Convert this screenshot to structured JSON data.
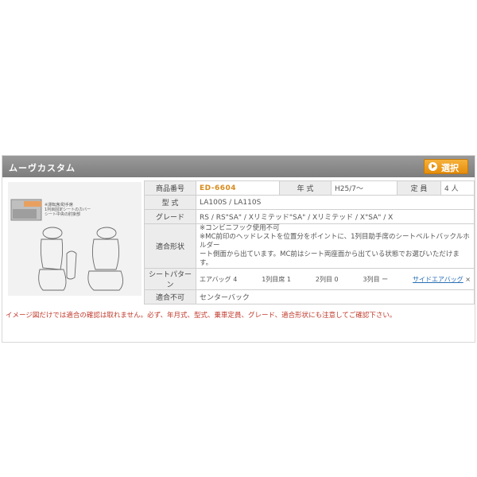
{
  "panel": {
    "title": "ムーヴカスタム",
    "select_label": "選択"
  },
  "image": {
    "caption_lines": [
      "※運転席/助手席",
      "1列目固定シートのカバー",
      "シート中央の肘掛部"
    ]
  },
  "spec": {
    "product_no_label": "商品番号",
    "product_no": "ED-6604",
    "year_label": "年 式",
    "year": "H25/7～",
    "capacity_label": "定 員",
    "capacity": "4 人",
    "model_label": "型 式",
    "model": "LA100S / LA110S",
    "grade_label": "グレード",
    "grade": "RS / RS\"SA\" / Xリミテッド\"SA\" / Xリミテッド / X\"SA\" / X",
    "fit_label": "適合形状",
    "fit_line1": "※コンビニフック使用不可",
    "fit_line2": "※MC前印のヘッドレストを位置分をポイントに、1列目助手席のシートベルトバックルホルダー",
    "fit_line3": "ート側面から出ています。MC前はシート両座面から出ている状態でお選びいただけます。",
    "seat_label": "シートパターン",
    "seat_1": "エアバッグ 4",
    "seat_2": "1列目席 1",
    "seat_3": "2列目 0",
    "seat_4": "3列目 ー",
    "airbag_link": "サイドエアバッグ",
    "airbag_mark": "×",
    "ng_label": "適合不可",
    "ng_value": "センターバック"
  },
  "notice": "イメージ図だけでは適合の確認は取れません。必ず、年月式、型式、乗車定員、グレード、適合形状にも注意してご確認下さい。"
}
